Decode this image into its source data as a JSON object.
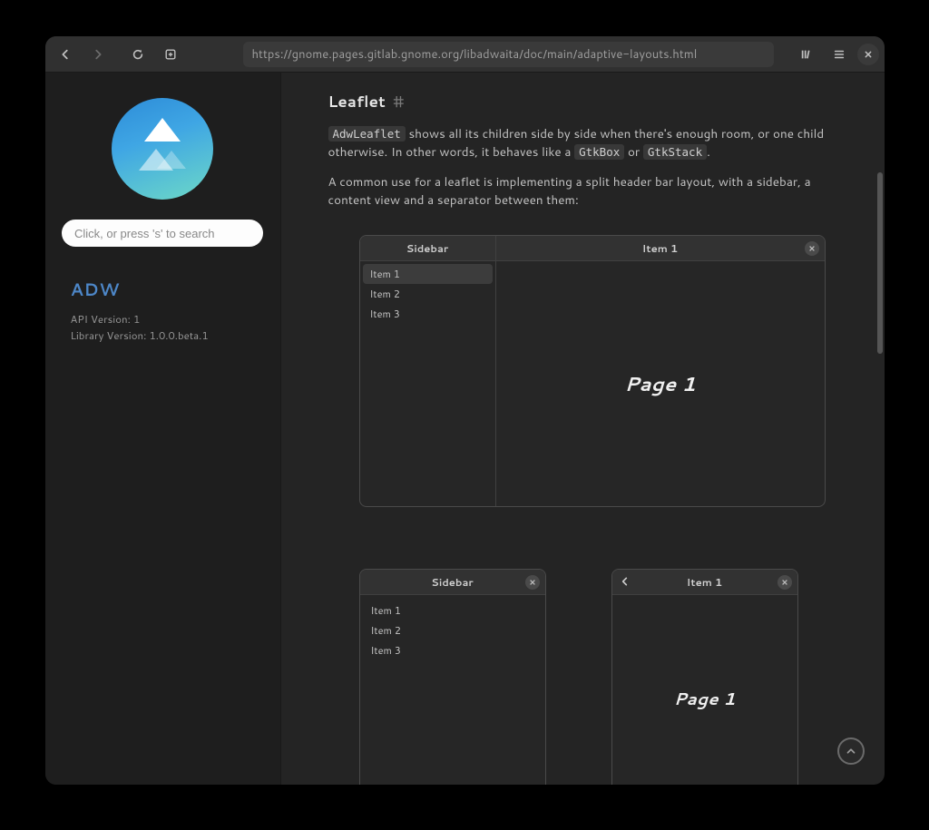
{
  "toolbar": {
    "url": "https://gnome.pages.gitlab.gnome.org/libadwaita/doc/main/adaptive-layouts.html"
  },
  "sidebar": {
    "search_placeholder": "Click, or press 's' to search",
    "title": "ADW",
    "api_line": "API Version: 1",
    "lib_line": "Library Version: 1.0.0.beta.1"
  },
  "section": {
    "heading": "Leaflet",
    "hash": "#",
    "p1_a": "AdwLeaflet",
    "p1_b": " shows all its children side by side when there's enough room, or one child otherwise. In other words, it behaves like a ",
    "p1_c": "GtkBox",
    "p1_d": " or ",
    "p1_e": "GtkStack",
    "p1_f": ".",
    "p2": "A common use for a leaflet is implementing a split header bar layout, with a sidebar, a content view and a separator between them:"
  },
  "demo": {
    "sidebar_label": "Sidebar",
    "content_label": "Item 1",
    "items": [
      "Item 1",
      "Item 2",
      "Item 3"
    ],
    "page_label": "Page 1"
  }
}
